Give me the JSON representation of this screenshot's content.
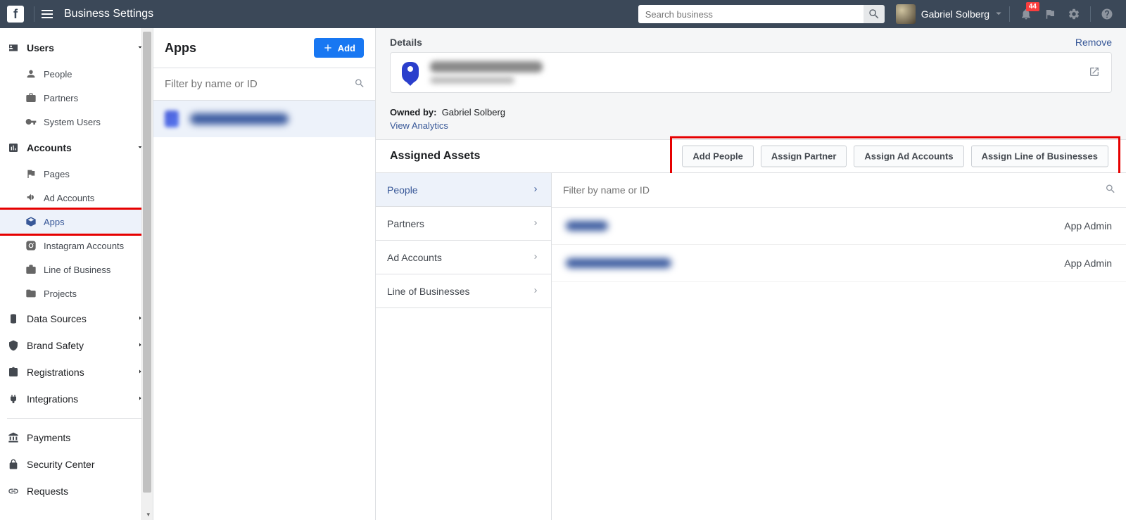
{
  "header": {
    "page_title": "Business Settings",
    "search_placeholder": "Search business",
    "user_name": "Gabriel Solberg",
    "notification_count": "44"
  },
  "sidebar": {
    "sections": {
      "users": {
        "label": "Users",
        "items": [
          {
            "label": "People"
          },
          {
            "label": "Partners"
          },
          {
            "label": "System Users"
          }
        ]
      },
      "accounts": {
        "label": "Accounts",
        "items": [
          {
            "label": "Pages"
          },
          {
            "label": "Ad Accounts"
          },
          {
            "label": "Apps"
          },
          {
            "label": "Instagram Accounts"
          },
          {
            "label": "Line of Business"
          },
          {
            "label": "Projects"
          }
        ]
      }
    },
    "other": [
      {
        "label": "Data Sources"
      },
      {
        "label": "Brand Safety"
      },
      {
        "label": "Registrations"
      },
      {
        "label": "Integrations"
      }
    ],
    "footer": [
      {
        "label": "Payments"
      },
      {
        "label": "Security Center"
      },
      {
        "label": "Requests"
      }
    ]
  },
  "midcol": {
    "title": "Apps",
    "add_button": "Add",
    "filter_placeholder": "Filter by name or ID"
  },
  "detail": {
    "details_label": "Details",
    "remove_label": "Remove",
    "owned_by_label": "Owned by:",
    "owned_by_value": "Gabriel Solberg",
    "view_analytics": "View Analytics",
    "assigned_assets_title": "Assigned Assets",
    "action_buttons": [
      "Add People",
      "Assign Partner",
      "Assign Ad Accounts",
      "Assign Line of Businesses"
    ],
    "asset_tabs": [
      "People",
      "Partners",
      "Ad Accounts",
      "Line of Businesses"
    ],
    "assigned_filter_placeholder": "Filter by name or ID",
    "assigned_people": [
      {
        "role": "App Admin"
      },
      {
        "role": "App Admin"
      }
    ]
  }
}
